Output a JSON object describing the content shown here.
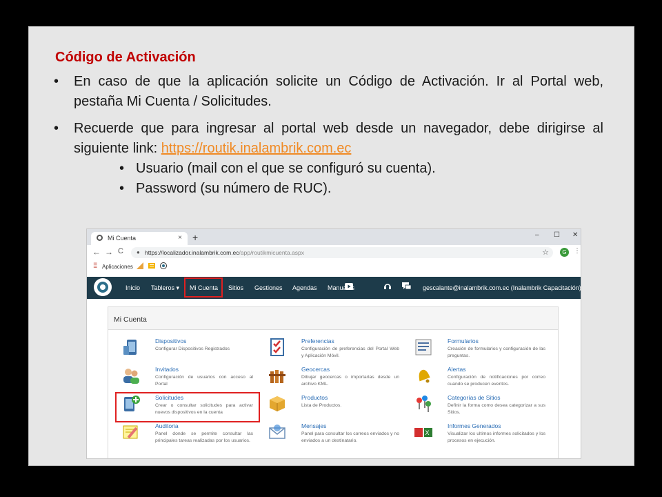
{
  "slide": {
    "title": "Código de Activación",
    "bullet1": "En caso de que la aplicación solicite un Código de Activación. Ir al Portal web, pestaña Mi Cuenta / Solicitudes.",
    "bullet2_text": "Recuerde que para ingresar al portal web desde un navegador, debe dirigirse al siguiente link: ",
    "bullet2_link": "https://routik.inalambrik.com.ec",
    "sub1": "Usuario (mail con el que se configuró su cuenta).",
    "sub2": "Password (su número de RUC).",
    "bullet_glyph": "•",
    "colors": {
      "title": "#c00000",
      "link": "#f08a24"
    }
  },
  "browser": {
    "tab_title": "Mi Cuenta",
    "tab_close": "×",
    "new_tab": "+",
    "window_controls": [
      "–",
      "☐",
      "✕"
    ],
    "nav_back": "←",
    "nav_forward": "→",
    "nav_reload": "C",
    "url_host": "https://localizador.inalambrik.com.ec",
    "url_path": "/app/routikmicuenta.aspx",
    "profile_initial": "G",
    "menu_glyph": "⋮",
    "bookmarks_label": "Aplicaciones",
    "icons": [
      "favicon-icon",
      "lock-icon",
      "star-icon",
      "apps-grid-icon"
    ]
  },
  "navbar": {
    "items": [
      "Inicio",
      "Tableros ▾",
      "Mi Cuenta",
      "Sitios",
      "Gestiones",
      "Agendas",
      "Manuales"
    ],
    "user": "gescalante@inalambrik.com.ec (Inalambrik Capacitación)▾",
    "icons": [
      "youtube-icon",
      "headset-icon",
      "chat-icon"
    ],
    "colors": {
      "bg": "#1d3b4a",
      "highlight": "#e02020"
    }
  },
  "panel": {
    "title": "Mi Cuenta",
    "items": [
      {
        "name": "Dispositivos",
        "desc": "Configurar Dispositivos Registrados",
        "icon": "device-icon"
      },
      {
        "name": "Preferencias",
        "desc": "Configuración de preferencias del Portal Web y Aplicación Móvil.",
        "icon": "checklist-icon"
      },
      {
        "name": "Formularios",
        "desc": "Creación de formularios y configuración de las preguntas.",
        "icon": "form-icon"
      },
      {
        "name": "Invitados",
        "desc": "Configuración de usuarios con acceso al Portal",
        "icon": "users-icon"
      },
      {
        "name": "Geocercas",
        "desc": "Dibujar geocercas o importarlas desde un archivo KML.",
        "icon": "fence-icon"
      },
      {
        "name": "Alertas",
        "desc": "Configuración de notificaciones por correo cuando se producen eventos.",
        "icon": "bell-icon"
      },
      {
        "name": "Solicitudes",
        "desc": "Crear o consultar solicitudes para activar nuevos dispositivos en la cuenta",
        "icon": "add-device-icon"
      },
      {
        "name": "Productos",
        "desc": "Lista de Productos.",
        "icon": "box-icon"
      },
      {
        "name": "Categorías de Sitios",
        "desc": "Definir la forma como desea categorizar a sus Sitios.",
        "icon": "pins-icon"
      },
      {
        "name": "Auditoria",
        "desc": "Panel donde se permite consultar las principales tareas realizadas por los usuarios.",
        "icon": "pencil-note-icon"
      },
      {
        "name": "Mensajes",
        "desc": "Panel para consultar los correos enviados y no enviados a un destinatario.",
        "icon": "mail-icon"
      },
      {
        "name": "Informes Generados",
        "desc": "Visualizar los ultimos informes solicitados y los procesos en ejecución.",
        "icon": "report-icon"
      }
    ]
  }
}
